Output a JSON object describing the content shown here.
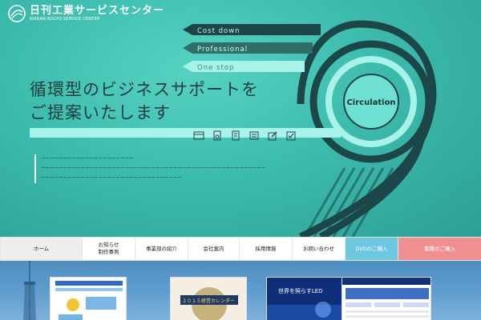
{
  "brand": {
    "name_ja": "日刊工業サービスセンター",
    "name_en": "NIKKAN KOGYO SERVICE CENTER"
  },
  "hero": {
    "ribbons": [
      "Cost down",
      "Professional",
      "One stop"
    ],
    "circle_label": "Circulation",
    "headline": [
      "循環型のビジネスサポートを",
      "ご提案いたします"
    ],
    "intro": [
      "ーーーーーーーーーーーーーーーーーーーーー",
      "ーーーーーーーーーーーーーーーーーーーーーーーーーーーーーーーーーーーーーーーーーーーーーーーーーーー",
      "ーーーーーーーーーーーーーーーーーーーーーーーーーーーーーーーー"
    ],
    "icons": [
      "window-icon",
      "document-gear-icon",
      "building-icon",
      "list-icon",
      "edit-icon",
      "checkbox-icon"
    ]
  },
  "nav": {
    "home": "ホーム",
    "news_line1": "お知らせ",
    "news_line2": "制作事例",
    "divisions": "事業部の紹介",
    "company": "会社案内",
    "recruit": "採用情報",
    "contact": "お問い合わせ",
    "dvd": "DVDのご購入",
    "books": "書籍のご購入"
  },
  "thumbnails": {
    "thumb2_caption": "２０１５経営カレンダー",
    "thumb3_title": "世界を照らすLED"
  },
  "colors": {
    "hero_teal": "#3cbcad",
    "ring_dark": "#1d4648",
    "ring_light": "#a9f2e9",
    "dvd_blue": "#6dc7e0",
    "book_pink": "#ef8f90"
  }
}
